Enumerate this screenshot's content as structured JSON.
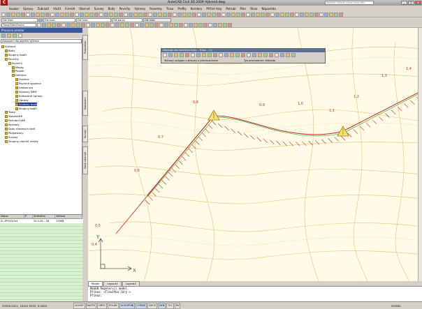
{
  "window": {
    "logo": "C",
    "title": "AutoCAD Civil 3D 2009  Výkres4.dwg",
    "search_placeholder": "Zadejte klíčové slovo nebo větu",
    "btn_min": "_",
    "btn_max": "□",
    "btn_close": "✕"
  },
  "menus": [
    "Soubor",
    "Úpravy",
    "Zobrazit",
    "Vložit",
    "Formát",
    "Obecné",
    "Survey",
    "Body",
    "Povrchy",
    "Výkresy",
    "Pozemky",
    "Trasa",
    "Profily",
    "Koridory",
    "Příčné řezy",
    "Potrubí",
    "Plán",
    "Okno",
    "Nápověda"
  ],
  "toolbar2": {
    "layer_combo": "Dle hlad.",
    "color_combo": "Dle hlad.",
    "linetype_combo": "Dle hlad.",
    "lineweight_combo": "Dle barvy"
  },
  "toolbar3": {
    "style_combo": "Trasa/Staničování"
  },
  "panel": {
    "title": "Pracovní prostor",
    "select_value": "Zobrazení dle objektu výkresu",
    "tree": [
      {
        "label": "Výkres4",
        "indent": 0,
        "selected": false
      },
      {
        "label": "Body",
        "indent": 1,
        "selected": false
      },
      {
        "label": "Skupiny bodů",
        "indent": 1,
        "selected": false
      },
      {
        "label": "Povrchy",
        "indent": 1,
        "selected": false
      },
      {
        "label": "Povrch1",
        "indent": 2,
        "selected": false
      },
      {
        "label": "Masky",
        "indent": 3,
        "selected": false
      },
      {
        "label": "Povodí",
        "indent": 3,
        "selected": false
      },
      {
        "label": "Definice",
        "indent": 3,
        "selected": false
      },
      {
        "label": "Hranice",
        "indent": 4,
        "selected": false
      },
      {
        "label": "Povinné spojnice",
        "indent": 4,
        "selected": false
      },
      {
        "label": "Vrstevnice",
        "indent": 4,
        "selected": false
      },
      {
        "label": "Soubory DEM",
        "indent": 4,
        "selected": false
      },
      {
        "label": "Editované úpravy",
        "indent": 4,
        "selected": false
      },
      {
        "label": "Úpravy",
        "indent": 4,
        "selected": false
      },
      {
        "label": "Soubory bodů",
        "indent": 4,
        "selected": true
      },
      {
        "label": "Skupiny bodů",
        "indent": 4,
        "selected": false
      },
      {
        "label": "Trasy",
        "indent": 1,
        "selected": false
      },
      {
        "label": "Staveniště",
        "indent": 1,
        "selected": false
      },
      {
        "label": "Potrubní sítě",
        "indent": 1,
        "selected": false
      },
      {
        "label": "Koridory",
        "indent": 1,
        "selected": false
      },
      {
        "label": "Sady shodných řezů",
        "indent": 1,
        "selected": false
      },
      {
        "label": "Podsestavy",
        "indent": 1,
        "selected": false
      },
      {
        "label": "Survey",
        "indent": 1,
        "selected": false
      },
      {
        "label": "Skupiny návrhů vrstev",
        "indent": 1,
        "selected": false
      }
    ],
    "vtabs": [
      "Prospektor",
      "Nastavení",
      "Survey",
      "Sada nástrojů"
    ],
    "table": {
      "headers": [
        "Název",
        "P",
        "Změněno",
        "Velikost"
      ],
      "row": [
        "D...PROZA.txt",
        "",
        "20.3.20... 28",
        "135KB"
      ]
    }
  },
  "floatbar": {
    "title": "Nástroje pro rozvržení trasy – Trasa – (1)",
    "left_label": "Tečnový polygon s oblouky a přechodnicemi",
    "right_label": "Typ přechodnice: Klotoida"
  },
  "drawing": {
    "station_labels": [
      "0,5",
      "0,6",
      "0,7",
      "0,8",
      "0,9",
      "1,0",
      "1,1",
      "1,2",
      "1,3",
      "1,4",
      "0,4"
    ],
    "axis_y": "Y",
    "axis_x": "X"
  },
  "layout_tabs": [
    "Model",
    "Layout1",
    "Layout2"
  ],
  "command_lines": [
    "REGEN Regeneruji model.",
    "Příkaz:  <Tloušťka čáry >",
    "Příkaz:"
  ],
  "status": {
    "coordinates": "29300.0411, 19401.9253, 0.0000",
    "buttons": [
      "UCHOP",
      "RASTR",
      "ORTO",
      "POLÁR",
      "UCHOPOBJ",
      "OTRAS",
      "DUCS",
      "DYN",
      "TLČ",
      "RV"
    ],
    "active_buttons": [
      "UCHOPOBJ",
      "OTRAS",
      "DYN"
    ],
    "right_label": "MODEL"
  }
}
